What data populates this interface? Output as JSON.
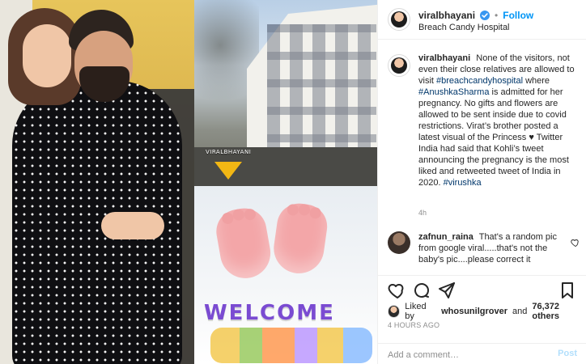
{
  "colors": {
    "accent": "#0095f6",
    "verified": "#3897f0",
    "muted": "#8e8e8e",
    "tag": "#00376b"
  },
  "header": {
    "username": "viralbhayani",
    "follow_label": "Follow",
    "location": "Breach Candy Hospital",
    "verified_icon": "verified-badge-icon"
  },
  "media": {
    "watermark_text": "VIRALBHAYANI",
    "welcome_text": "WELCOME"
  },
  "caption": {
    "username": "viralbhayani",
    "segments": [
      "None of the visitors, not even their close relatives are allowed to visit ",
      "#breachcandyhospital",
      " where ",
      "#AnushkaSharma",
      " is admitted for her pregnancy. No gifts and flowers are allowed to be sent inside due to covid restrictions. Virat’s brother posted a latest visual of the Princess ",
      "♥",
      " Twitter India had said that Kohli’s tweet announcing the pregnancy is the most liked and retweeted tweet of India in 2020. ",
      "#virushka"
    ],
    "time": "4h"
  },
  "comments": [
    {
      "username": "zafnun_raina",
      "text": "That's a random pic from google viral.....that's not the baby's pic....please correct it"
    }
  ],
  "actions": {
    "like_icon": "heart-icon",
    "comment_icon": "comment-bubble-icon",
    "share_icon": "paper-plane-icon",
    "save_icon": "bookmark-icon"
  },
  "likes": {
    "prefix": "Liked by",
    "user": "whosunilgrover",
    "conj": "and",
    "others": "76,372 others"
  },
  "posted": "4 HOURS AGO",
  "comment_box": {
    "placeholder": "Add a comment…",
    "post_label": "Post"
  }
}
